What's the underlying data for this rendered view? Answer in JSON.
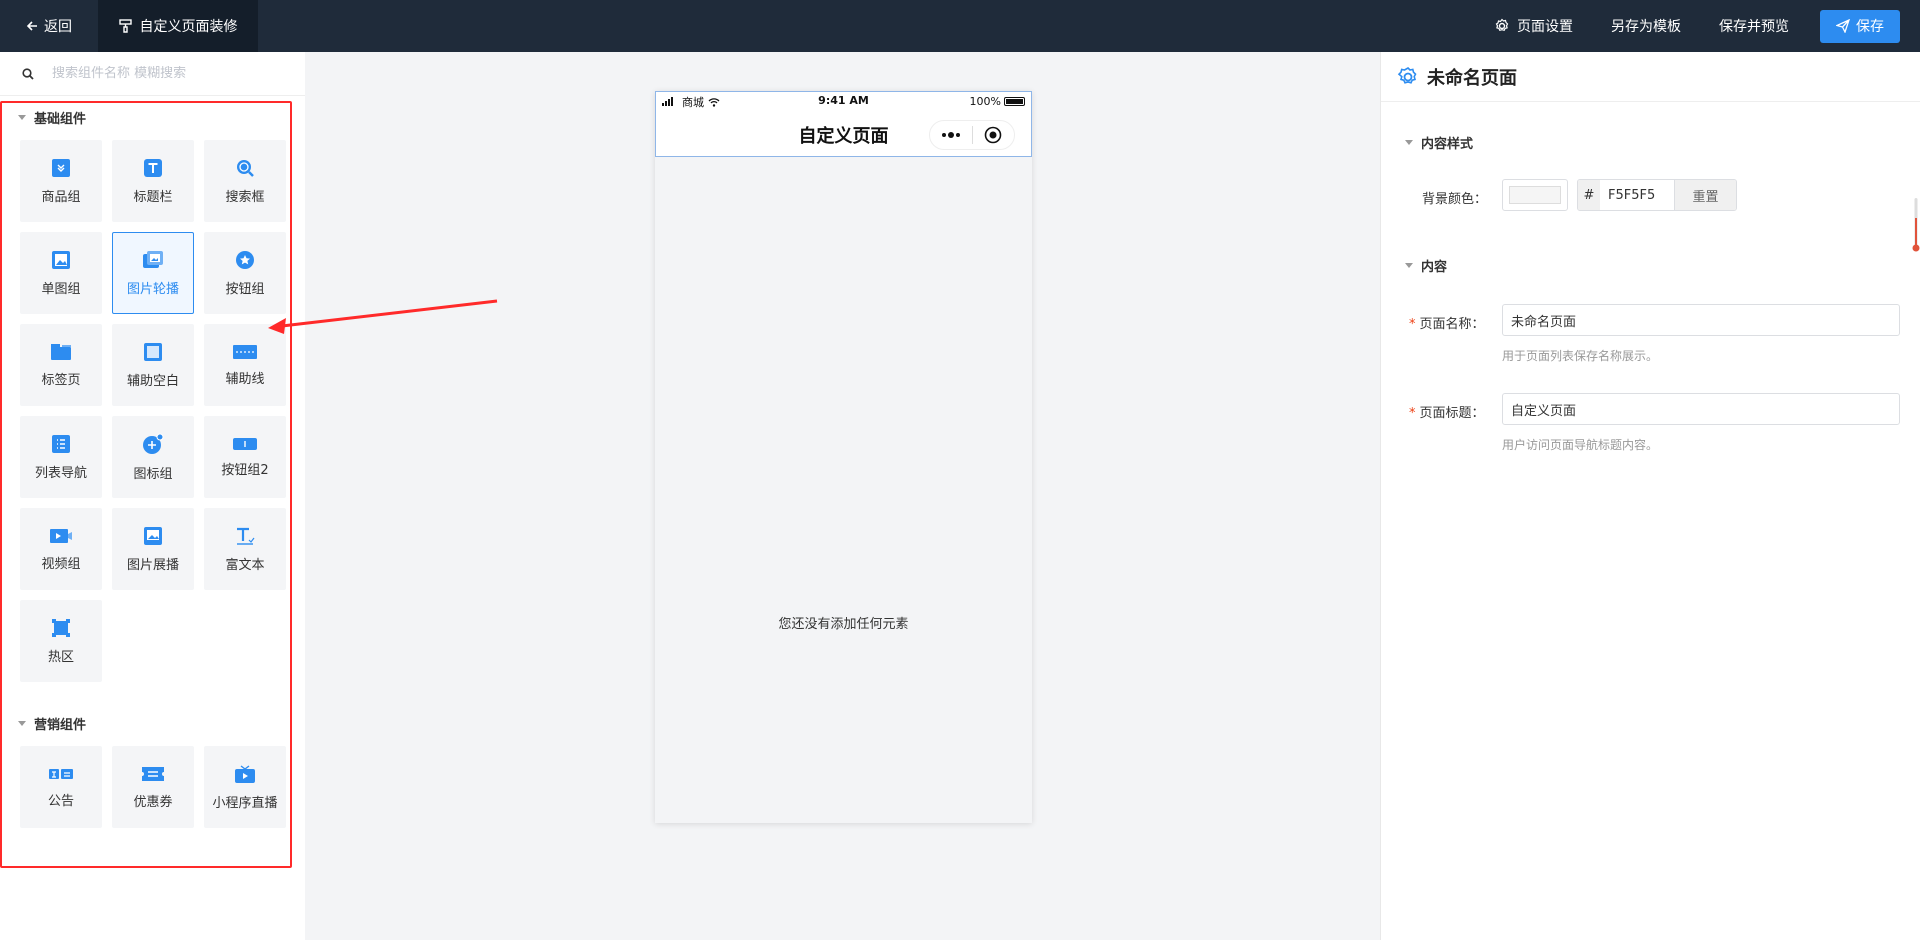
{
  "topbar": {
    "back_label": "返回",
    "page_title": "自定义页面装修",
    "page_settings_label": "页面设置",
    "save_template_label": "另存为模板",
    "save_preview_label": "保存并预览",
    "save_label": "保存"
  },
  "sidebar": {
    "search_placeholder": "搜索组件名称 模糊搜索",
    "basic_section": {
      "title": "基础组件",
      "items": [
        {
          "label": "商品组",
          "icon": "product-group-icon"
        },
        {
          "label": "标题栏",
          "icon": "title-bar-icon"
        },
        {
          "label": "搜索框",
          "icon": "search-box-icon"
        },
        {
          "label": "单图组",
          "icon": "single-image-icon"
        },
        {
          "label": "图片轮播",
          "icon": "carousel-icon",
          "active": true
        },
        {
          "label": "按钮组",
          "icon": "button-group-icon"
        },
        {
          "label": "标签页",
          "icon": "tabs-icon"
        },
        {
          "label": "辅助空白",
          "icon": "blank-space-icon"
        },
        {
          "label": "辅助线",
          "icon": "divider-line-icon"
        },
        {
          "label": "列表导航",
          "icon": "list-nav-icon"
        },
        {
          "label": "图标组",
          "icon": "icon-group-icon"
        },
        {
          "label": "按钮组2",
          "icon": "button-group2-icon"
        },
        {
          "label": "视频组",
          "icon": "video-group-icon"
        },
        {
          "label": "图片展播",
          "icon": "image-showcase-icon"
        },
        {
          "label": "富文本",
          "icon": "rich-text-icon"
        },
        {
          "label": "热区",
          "icon": "hotspot-icon"
        }
      ]
    },
    "marketing_section": {
      "title": "营销组件",
      "items": [
        {
          "label": "公告",
          "icon": "announcement-icon"
        },
        {
          "label": "优惠券",
          "icon": "coupon-icon"
        },
        {
          "label": "小程序直播",
          "icon": "live-stream-icon"
        }
      ]
    }
  },
  "phone": {
    "carrier": "商城",
    "time": "9:41 AM",
    "battery": "100%",
    "title": "自定义页面",
    "empty_text": "您还没有添加任何元素"
  },
  "panel": {
    "title": "未命名页面",
    "style_section": "内容样式",
    "bg_color_label": "背景颜色：",
    "bg_color_hex": "F5F5F5",
    "hash": "#",
    "reset_label": "重置",
    "content_section": "内容",
    "page_name_label": "页面名称：",
    "page_name_value": "未命名页面",
    "page_name_hint": "用于页面列表保存名称展示。",
    "page_title_label": "页面标题：",
    "page_title_value": "自定义页面",
    "page_title_hint": "用户访问页面导航标题内容。"
  },
  "colors": {
    "topbar": "#1f2b3a",
    "accent": "#2d8cf0",
    "highlight_box": "#ff2a2a"
  }
}
